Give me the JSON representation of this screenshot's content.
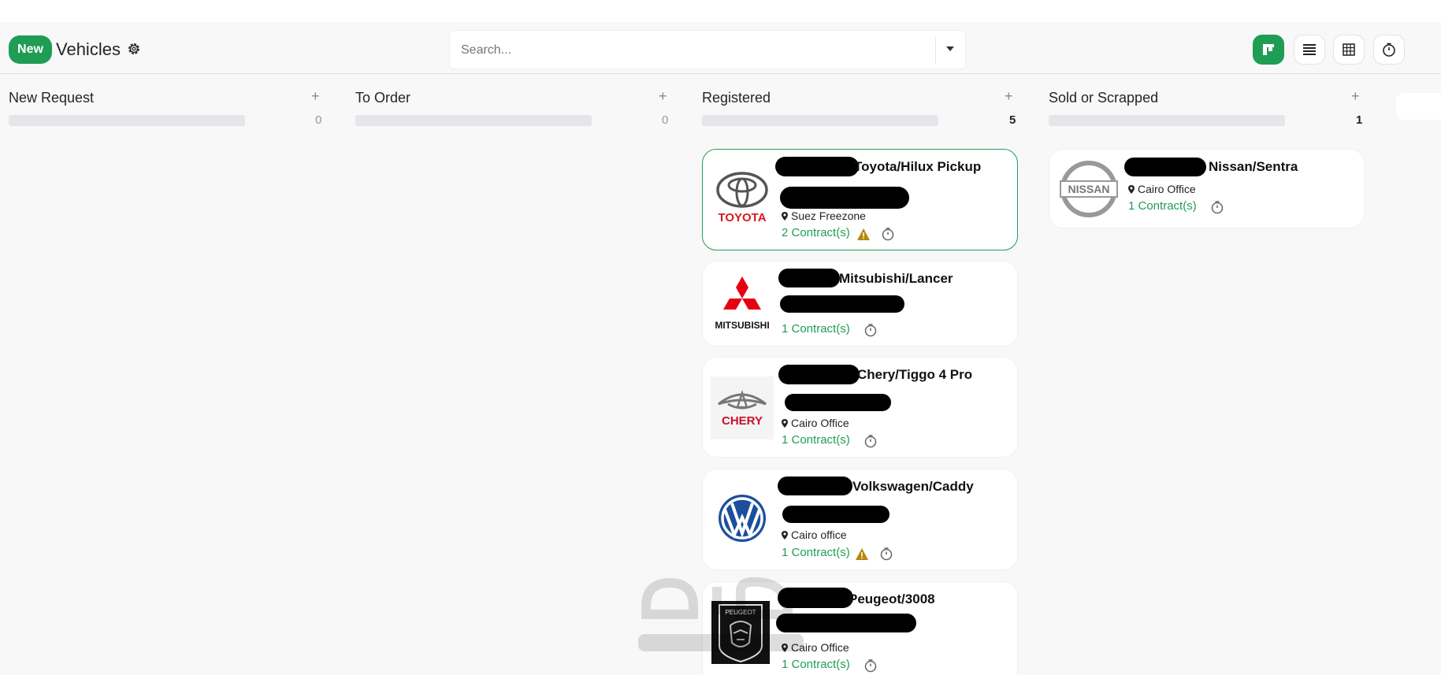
{
  "control_panel": {
    "new_label": "New",
    "title": "Vehicles",
    "search_placeholder": "Search..."
  },
  "columns": [
    {
      "title": "New Request",
      "count": "0"
    },
    {
      "title": "To Order",
      "count": "0"
    },
    {
      "title": "Registered",
      "count": "5"
    },
    {
      "title": "Sold or Scrapped",
      "count": "1"
    }
  ],
  "cards": {
    "toyota": {
      "brand": "TOYOTA",
      "model": "Toyota/Hilux Pickup",
      "location": "Suez Freezone",
      "contracts": "2 Contract(s)"
    },
    "mitsubishi": {
      "brand": "MITSUBISHI",
      "model": "Mitsubishi/Lancer",
      "contracts": "1 Contract(s)"
    },
    "chery": {
      "brand": "CHERY",
      "model": "Chery/Tiggo 4 Pro",
      "location": "Cairo Office",
      "contracts": "1 Contract(s)"
    },
    "volkswagen": {
      "model": "Volkswagen/Caddy",
      "location": "Cairo office",
      "contracts": "1 Contract(s)"
    },
    "peugeot": {
      "brand": "PEUGEOT",
      "model": "Peugeot/3008",
      "location": "Cairo Office",
      "contracts": "1 Contract(s)"
    },
    "nissan": {
      "brand": "NISSAN",
      "model": "Nissan/Sentra",
      "location": "Cairo Office",
      "contracts": "1 Contract(s)"
    }
  },
  "colors": {
    "accent": "#1f9d55",
    "warning": "#b8860b"
  },
  "icons": [
    "gear-icon",
    "kanban-view-icon",
    "list-view-icon",
    "pivot-view-icon",
    "activity-view-icon",
    "clock-icon",
    "warning-icon",
    "map-marker-icon"
  ]
}
